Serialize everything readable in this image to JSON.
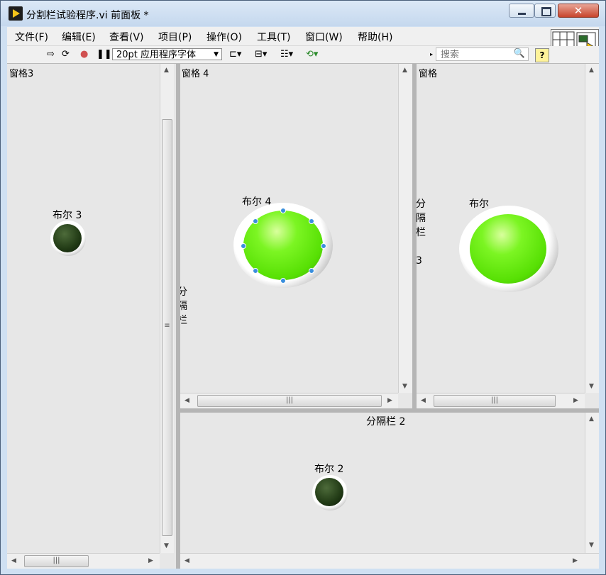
{
  "window": {
    "title": "分割栏试验程序.vi 前面板 *"
  },
  "menu": [
    "文件(F)",
    "编辑(E)",
    "查看(V)",
    "项目(P)",
    "操作(O)",
    "工具(T)",
    "窗口(W)",
    "帮助(H)"
  ],
  "toolbar": {
    "font": "20pt 应用程序字体",
    "search_placeholder": "搜索",
    "help": "?"
  },
  "panes": {
    "pane3": {
      "label": "窗格3",
      "led_label": "布尔 3",
      "led_state": "off"
    },
    "pane4": {
      "label": "窗格 4",
      "led_label": "布尔 4",
      "led_state": "on"
    },
    "pane_right": {
      "label": "窗格",
      "led_label": "布尔",
      "led_state": "on"
    },
    "pane2": {
      "led_label": "布尔 2",
      "led_state": "off"
    }
  },
  "splitters": {
    "splitter1": [
      "分",
      "隔",
      "栏"
    ],
    "splitter3": [
      "分",
      "隔",
      "栏",
      "",
      "3"
    ],
    "splitter2": "分隔栏 2"
  },
  "colors": {
    "led_on": "#57e004",
    "led_off": "#213a15",
    "pane_bg": "#e7e7e7"
  }
}
